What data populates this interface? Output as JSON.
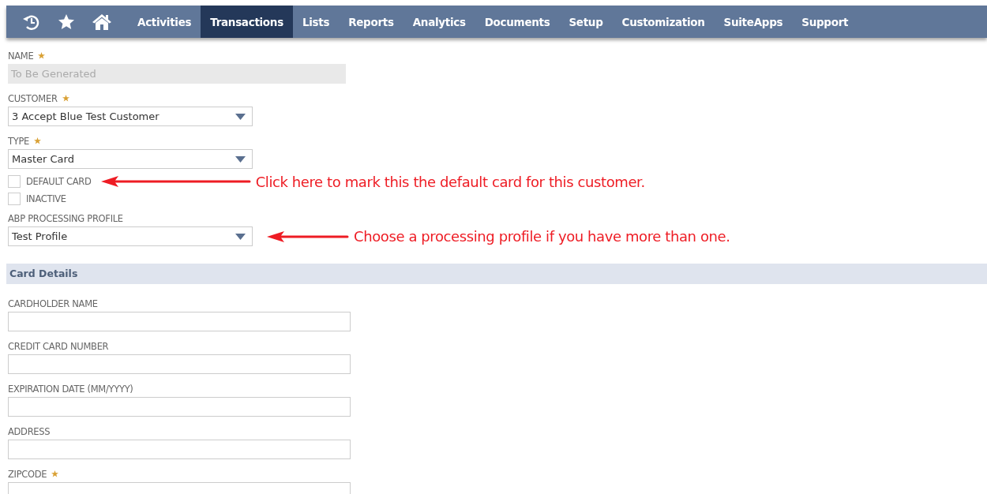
{
  "nav": {
    "items": [
      {
        "label": "Activities",
        "selected": false
      },
      {
        "label": "Transactions",
        "selected": true
      },
      {
        "label": "Lists",
        "selected": false
      },
      {
        "label": "Reports",
        "selected": false
      },
      {
        "label": "Analytics",
        "selected": false
      },
      {
        "label": "Documents",
        "selected": false
      },
      {
        "label": "Setup",
        "selected": false
      },
      {
        "label": "Customization",
        "selected": false
      },
      {
        "label": "SuiteApps",
        "selected": false
      },
      {
        "label": "Support",
        "selected": false
      }
    ]
  },
  "fields": [
    {
      "kind": "readonly",
      "label": "NAME",
      "required": true,
      "value": "To Be Generated"
    },
    {
      "kind": "select",
      "label": "CUSTOMER",
      "required": true,
      "value": "3 Accept Blue Test Customer"
    },
    {
      "kind": "select",
      "label": "TYPE",
      "required": true,
      "value": "Master Card"
    },
    {
      "kind": "checkbox",
      "label": "DEFAULT CARD",
      "checked": false,
      "annotation": "Click here to mark this the default card for this customer."
    },
    {
      "kind": "checkbox",
      "label": "INACTIVE",
      "checked": false
    },
    {
      "kind": "select",
      "label": "ABP PROCESSING PROFILE",
      "required": false,
      "value": "Test Profile",
      "annotation": "Choose a processing profile if you have more than one."
    }
  ],
  "section": {
    "title": "Card Details"
  },
  "card_fields": [
    {
      "kind": "text",
      "label": "CARDHOLDER NAME",
      "required": false
    },
    {
      "kind": "text",
      "label": "CREDIT CARD NUMBER",
      "required": false
    },
    {
      "kind": "text",
      "label": "EXPIRATION DATE (MM/YYYY)",
      "required": false
    },
    {
      "kind": "text",
      "label": "ADDRESS",
      "required": false
    },
    {
      "kind": "text",
      "label": "ZIPCODE",
      "required": true
    }
  ]
}
